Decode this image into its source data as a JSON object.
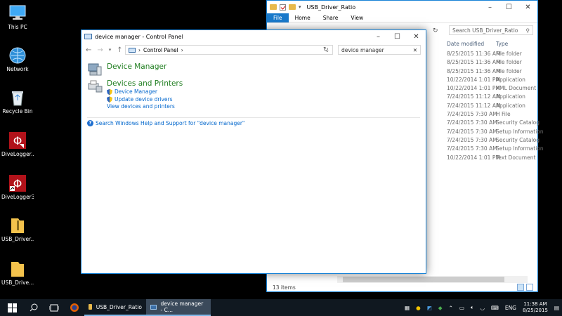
{
  "desktop": {
    "icons": [
      {
        "label": "This PC",
        "icon": "this-pc-icon"
      },
      {
        "label": "Network",
        "icon": "network-icon"
      },
      {
        "label": "Recycle Bin",
        "icon": "recycle-bin-icon"
      },
      {
        "label": "DiveLogger...",
        "icon": "divelogger-icon"
      },
      {
        "label": "DiveLogger3",
        "icon": "divelogger-icon"
      },
      {
        "label": "USB_Driver...",
        "icon": "zip-folder-icon"
      },
      {
        "label": "USB_Drive...",
        "icon": "folder-icon"
      }
    ]
  },
  "explorer": {
    "title": "USB_Driver_Ratio",
    "ribbon_tabs": [
      "File",
      "Home",
      "Share",
      "View"
    ],
    "search_placeholder": "Search USB_Driver_Ratio",
    "columns": {
      "date": "Date modified",
      "type": "Type"
    },
    "rows": [
      {
        "date": "8/25/2015 11:36 AM",
        "type": "File folder"
      },
      {
        "date": "8/25/2015 11:36 AM",
        "type": "File folder"
      },
      {
        "date": "8/25/2015 11:36 AM",
        "type": "File folder"
      },
      {
        "date": "10/22/2014 1:01 PM",
        "type": "Application"
      },
      {
        "date": "10/22/2014 1:01 PM",
        "type": "XML Document"
      },
      {
        "date": "7/24/2015 11:12 AM",
        "type": "Application"
      },
      {
        "date": "7/24/2015 11:12 AM",
        "type": "Application"
      },
      {
        "date": "7/24/2015 7:30 AM",
        "type": "H File"
      },
      {
        "date": "7/24/2015 7:30 AM",
        "type": "Security Catalog"
      },
      {
        "date": "7/24/2015 7:30 AM",
        "type": "Setup Information"
      },
      {
        "date": "7/24/2015 7:30 AM",
        "type": "Security Catalog"
      },
      {
        "date": "7/24/2015 7:30 AM",
        "type": "Setup Information"
      },
      {
        "date": "10/22/2014 1:01 PM",
        "type": "Text Document"
      }
    ],
    "status": "13 items"
  },
  "control_panel": {
    "title": "device manager - Control Panel",
    "breadcrumb": "Control Panel",
    "search_value": "device manager",
    "sections": [
      {
        "heading": "Device Manager",
        "links": []
      },
      {
        "heading": "Devices and Printers",
        "links": [
          {
            "label": "Device Manager",
            "shield": true
          },
          {
            "label": "Update device drivers",
            "shield": true
          },
          {
            "label": "View devices and printers",
            "shield": false
          }
        ]
      }
    ],
    "help_link": "Search Windows Help and Support for \"device manager\""
  },
  "taskbar": {
    "apps": [
      {
        "label": "USB_Driver_Ratio",
        "active": false
      },
      {
        "label": "device manager - C...",
        "active": true
      }
    ],
    "language": "ENG",
    "time": "11:38 AM",
    "date": "8/25/2015"
  }
}
